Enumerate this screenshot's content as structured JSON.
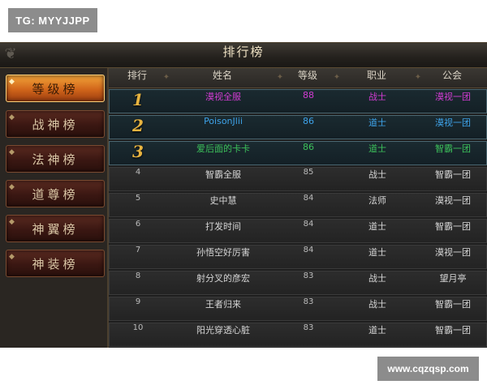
{
  "watermarks": {
    "top": "TG: MYYJJPP",
    "bottom": "www.cqzqsp.com"
  },
  "window": {
    "title": "排行榜"
  },
  "sidebar": {
    "tabs": [
      {
        "label": "等级榜",
        "active": true
      },
      {
        "label": "战神榜",
        "active": false
      },
      {
        "label": "法神榜",
        "active": false
      },
      {
        "label": "道尊榜",
        "active": false
      },
      {
        "label": "神翼榜",
        "active": false
      },
      {
        "label": "神装榜",
        "active": false
      }
    ]
  },
  "table": {
    "headers": {
      "rank": "排行",
      "name": "姓名",
      "level": "等级",
      "job": "职业",
      "guild": "公会"
    },
    "rows": [
      {
        "rank": "1",
        "name": "漠视全服",
        "level": "88",
        "job": "战士",
        "guild": "漠视一团",
        "color": "#d23cd2"
      },
      {
        "rank": "2",
        "name": "PoisonJlii",
        "level": "86",
        "job": "道士",
        "guild": "漠视一团",
        "color": "#3ea3ea"
      },
      {
        "rank": "3",
        "name": "爱后面的卡卡",
        "level": "86",
        "job": "道士",
        "guild": "智霸一团",
        "color": "#3cc05a"
      },
      {
        "rank": "4",
        "name": "智霸全服",
        "level": "85",
        "job": "战士",
        "guild": "智霸一团",
        "color": "#d5d5d5"
      },
      {
        "rank": "5",
        "name": "史中慧",
        "level": "84",
        "job": "法师",
        "guild": "漠视一团",
        "color": "#d5d5d5"
      },
      {
        "rank": "6",
        "name": "打发时间",
        "level": "84",
        "job": "道士",
        "guild": "智霸一团",
        "color": "#d5d5d5"
      },
      {
        "rank": "7",
        "name": "孙悟空好厉害",
        "level": "84",
        "job": "道士",
        "guild": "漠视一团",
        "color": "#d5d5d5"
      },
      {
        "rank": "8",
        "name": "射分叉的彦宏",
        "level": "83",
        "job": "战士",
        "guild": "望月亭",
        "color": "#d5d5d5"
      },
      {
        "rank": "9",
        "name": "王者归来",
        "level": "83",
        "job": "战士",
        "guild": "智霸一团",
        "color": "#d5d5d5"
      },
      {
        "rank": "10",
        "name": "阳光穿透心脏",
        "level": "83",
        "job": "道士",
        "guild": "智霸一团",
        "color": "#d5d5d5"
      }
    ]
  },
  "colors": {
    "active_tab": "#e0822a",
    "rank_gold": "#e8b440",
    "panel_bg": "#1b1b1b"
  },
  "icons": {
    "title_corner": "ornament-icon"
  }
}
